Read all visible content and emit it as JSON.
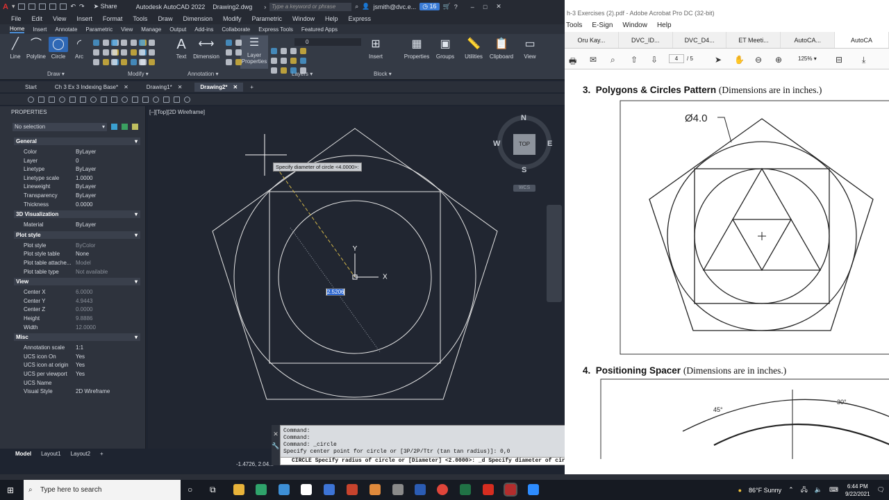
{
  "acad": {
    "app_title": "Autodesk AutoCAD 2022",
    "doc_title": "Drawing2.dwg",
    "share_label": "Share",
    "search_placeholder": "Type a keyword or phrase",
    "user": "jsmith@dvc.e...",
    "badge_count": "16",
    "menu": [
      "File",
      "Edit",
      "View",
      "Insert",
      "Format",
      "Tools",
      "Draw",
      "Dimension",
      "Modify",
      "Parametric",
      "Window",
      "Help",
      "Express"
    ],
    "ribbon_tabs": [
      "Home",
      "Insert",
      "Annotate",
      "Parametric",
      "View",
      "Manage",
      "Output",
      "Add-ins",
      "Collaborate",
      "Express Tools",
      "Featured Apps"
    ],
    "draw_tools": [
      "Line",
      "Polyline",
      "Circle",
      "Arc"
    ],
    "text_tool": "Text",
    "dimension_tool": "Dimension",
    "layer_props": "Layer Properties",
    "layer_value": "0",
    "insert_tool": "Insert",
    "right_tools": [
      "Properties",
      "Groups",
      "Utilities",
      "Clipboard",
      "View"
    ],
    "panels": [
      "Draw",
      "Modify",
      "Annotation",
      "Layers",
      "Block"
    ],
    "file_tabs": [
      "Start",
      "Ch 3 Ex 3 Indexing Base*",
      "Drawing1*",
      "Drawing2*"
    ],
    "viewport_label": "[–][Top][2D Wireframe]",
    "tooltip": "Specify diameter of circle <4.0000>:",
    "dyn_input": "2.5206",
    "compass": {
      "n": "N",
      "s": "S",
      "e": "E",
      "w": "W",
      "top": "TOP",
      "wcs": "WCS"
    },
    "ucs": {
      "x": "X",
      "y": "Y"
    },
    "layout_tabs": [
      "Model",
      "Layout1",
      "Layout2"
    ],
    "coords": "-1.4726, 2.04...",
    "cmd_lines": [
      "Command:",
      "Command:",
      "Command: _circle",
      "Specify center point for circle or [3P/2P/Ttr (tan tan radius)]: 0,0"
    ],
    "cmd_prompt": "CIRCLE Specify radius of circle or [Diameter] <2.0000>: _d Specify diameter of circle <4.0000>:"
  },
  "props": {
    "title": "PROPERTIES",
    "selection": "No selection",
    "sections": {
      "general": "General",
      "viz3d": "3D Visualization",
      "plot": "Plot style",
      "view": "View",
      "misc": "Misc"
    },
    "general": [
      [
        "Color",
        "ByLayer"
      ],
      [
        "Layer",
        "0"
      ],
      [
        "Linetype",
        "ByLayer"
      ],
      [
        "Linetype scale",
        "1.0000"
      ],
      [
        "Lineweight",
        "ByLayer"
      ],
      [
        "Transparency",
        "ByLayer"
      ],
      [
        "Thickness",
        "0.0000"
      ]
    ],
    "viz3d": [
      [
        "Material",
        "ByLayer"
      ]
    ],
    "plot": [
      [
        "Plot style",
        "ByColor"
      ],
      [
        "Plot style table",
        "None"
      ],
      [
        "Plot table attache...",
        "Model"
      ],
      [
        "Plot table type",
        "Not available"
      ]
    ],
    "view": [
      [
        "Center X",
        "6.0000"
      ],
      [
        "Center Y",
        "4.9443"
      ],
      [
        "Center Z",
        "0.0000"
      ],
      [
        "Height",
        "9.8886"
      ],
      [
        "Width",
        "12.0000"
      ]
    ],
    "misc": [
      [
        "Annotation scale",
        "1:1"
      ],
      [
        "UCS icon On",
        "Yes"
      ],
      [
        "UCS icon at origin",
        "Yes"
      ],
      [
        "UCS per viewport",
        "Yes"
      ],
      [
        "UCS Name",
        ""
      ],
      [
        "Visual Style",
        "2D Wireframe"
      ]
    ]
  },
  "acrobat": {
    "title": "h-3 Exercises (2).pdf - Adobe Acrobat Pro DC (32-bit)",
    "menu": [
      "Tools",
      "E-Sign",
      "Window",
      "Help"
    ],
    "tabs": [
      "Oru Kay...",
      "DVC_ID...",
      "DVC_D4...",
      "ET Meeti...",
      "AutoCA...",
      "AutoCA"
    ],
    "page_current": "4",
    "page_total": "/ 5",
    "zoom": "125%",
    "ex3_num": "3.",
    "ex3_title": "Polygons & Circles Pattern",
    "ex3_note": "(Dimensions are in inches.)",
    "dim_label": "Ø4.0",
    "ex4_num": "4.",
    "ex4_title": "Positioning Spacer",
    "ex4_note": "(Dimensions are in inches.)",
    "angle1": "45°",
    "angle2": "30°"
  },
  "taskbar": {
    "search_placeholder": "Type here to search",
    "weather": "86°F  Sunny",
    "time": "6:44 PM",
    "date": "9/22/2021"
  }
}
